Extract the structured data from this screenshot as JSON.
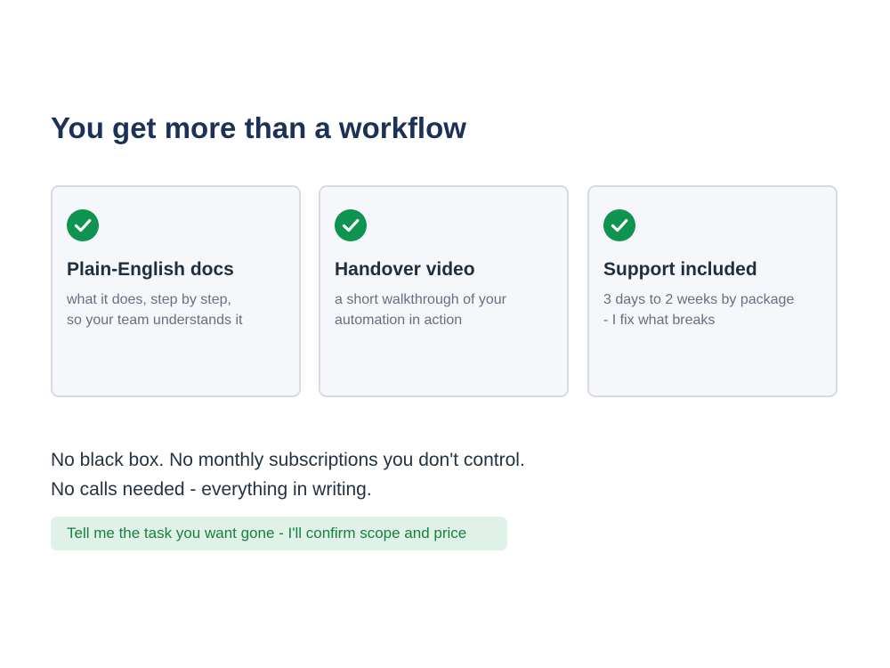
{
  "headline": "You get more than a workflow",
  "colors": {
    "heading": "#1b3157",
    "check": "#0e9350",
    "card_bg": "#f5f7fb",
    "card_border": "#d5dae3",
    "cta_bg": "#e0f2e7",
    "cta_text": "#17813f"
  },
  "cards": [
    {
      "icon": "check-circle-icon",
      "title": "Plain-English docs",
      "desc_line1": "what it does, step by step,",
      "desc_line2": "so your team understands it"
    },
    {
      "icon": "check-circle-icon",
      "title": "Handover video",
      "desc_line1": "a short walkthrough of your",
      "desc_line2": "automation in action"
    },
    {
      "icon": "check-circle-icon",
      "title": "Support included",
      "desc_line1": "3 days to 2 weeks by package",
      "desc_line2": "- I fix what breaks"
    }
  ],
  "body": {
    "line1": "No black box. No monthly subscriptions you don't control.",
    "line2": "No calls needed - everything in writing."
  },
  "cta": {
    "label": "Tell me the task you want gone - I'll confirm scope and price"
  }
}
